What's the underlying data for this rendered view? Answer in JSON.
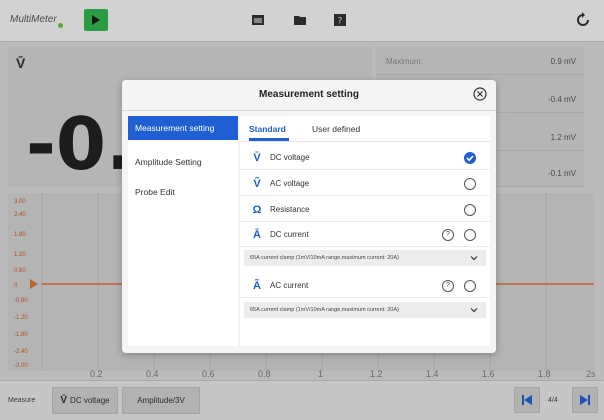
{
  "app": {
    "title": "MultiMeter"
  },
  "readout": {
    "unit_symbol": "V̄",
    "value": "-0."
  },
  "stats": [
    {
      "label": "Maximum:",
      "value": "0.9 mV"
    },
    {
      "label": "",
      "value": "-0.4 mV"
    },
    {
      "label": "",
      "value": "1.2 mV"
    },
    {
      "label": "",
      "value": "-0.1 mV"
    }
  ],
  "graph": {
    "y_ticks": [
      "3.00",
      "2.40",
      "1.80",
      "1.20",
      "0.60",
      "0",
      "-0.60",
      "-1.20",
      "-1.80",
      "-2.40",
      "-3.00"
    ],
    "x_ticks": [
      "0.2",
      "0.4",
      "0.6",
      "0.8",
      "1",
      "1.2",
      "1.4",
      "1.6",
      "1.8",
      "2s"
    ]
  },
  "bottombar": {
    "measure_label": "Measure",
    "measure_value": "DC voltage",
    "amplitude": "Amplitude/3V",
    "page": "4/4"
  },
  "modal": {
    "title": "Measurement setting",
    "sidebar": [
      "Measurement setting",
      "Amplitude Setting",
      "Probe Edit"
    ],
    "tabs": [
      "Standard",
      "User defined"
    ],
    "options": [
      {
        "symbol": "V̄",
        "label": "DC voltage",
        "selected": true
      },
      {
        "symbol": "Ṽ",
        "label": "AC voltage",
        "selected": false
      },
      {
        "symbol": "Ω",
        "label": "Resistance",
        "selected": false
      },
      {
        "symbol": "Ā",
        "label": "DC current",
        "selected": false,
        "help": "?"
      },
      {
        "symbol": "Ã",
        "label": "AC current",
        "selected": false,
        "help": "?"
      }
    ],
    "dc_current_sub": "65A current clamp (1mV/10mA range,maximum current: 20A)",
    "ac_current_sub": "65A current clamp (1mV/10mA range,maximum current: 20A)"
  },
  "colors": {
    "accent": "#1f5fd1",
    "play": "#2fb24c",
    "trace": "#d8733a"
  }
}
